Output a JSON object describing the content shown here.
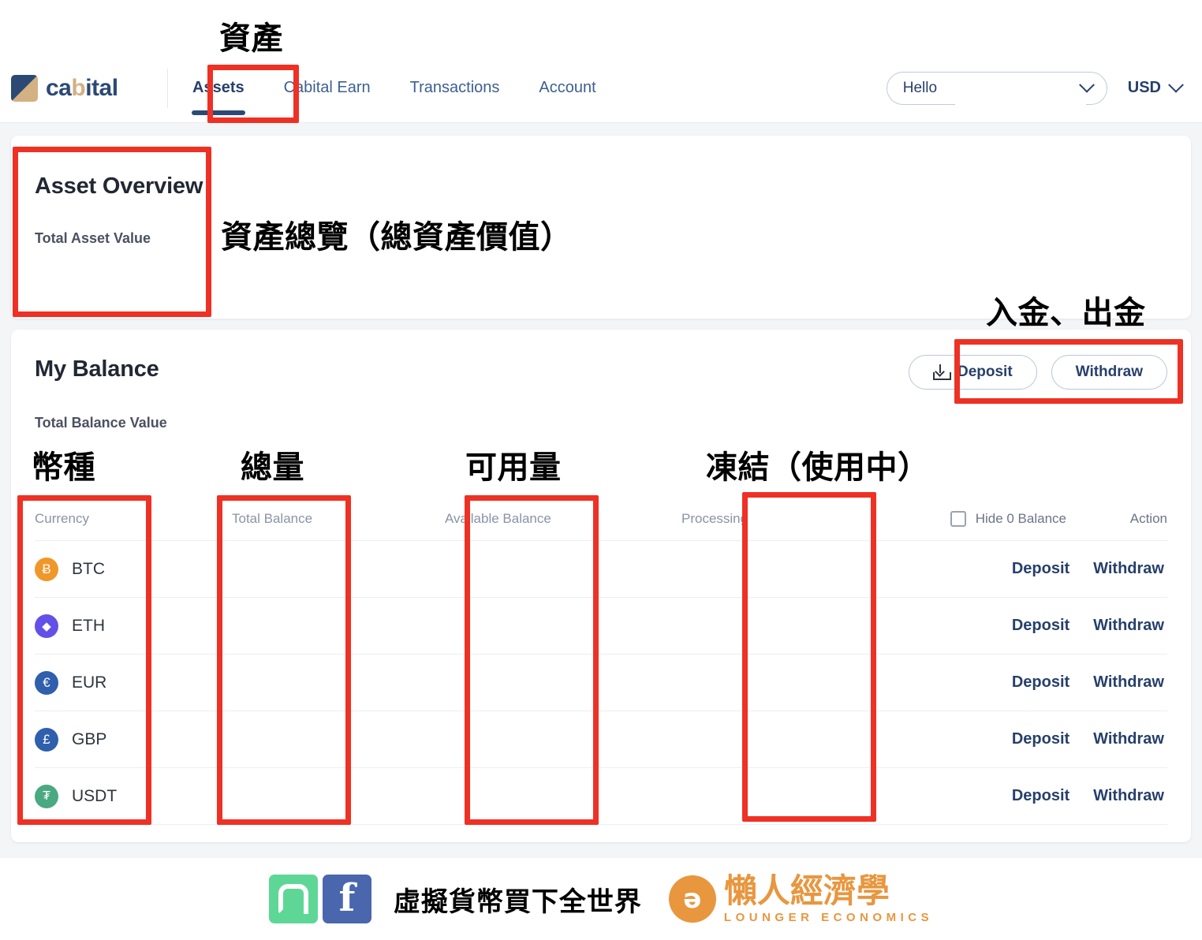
{
  "header": {
    "brand_prefix": "ca",
    "brand_mid": "b",
    "brand_suffix": "ital",
    "brand_full": "cabital",
    "nav": [
      {
        "label": "Assets",
        "active": true
      },
      {
        "label": "Cabital Earn",
        "active": false
      },
      {
        "label": "Transactions",
        "active": false
      },
      {
        "label": "Account",
        "active": false
      }
    ],
    "user_greeting": "Hello",
    "currency_selector": "USD"
  },
  "asset_overview": {
    "title": "Asset Overview",
    "subtitle": "Total Asset Value"
  },
  "my_balance": {
    "title": "My Balance",
    "subtitle": "Total Balance Value",
    "deposit_button": "Deposit",
    "withdraw_button": "Withdraw",
    "columns": {
      "currency": "Currency",
      "total_balance": "Total Balance",
      "available_balance": "Available Balance",
      "processing": "Processing",
      "hide_zero": "Hide 0 Balance",
      "action": "Action"
    },
    "row_deposit": "Deposit",
    "row_withdraw": "Withdraw",
    "rows": [
      {
        "ticker": "BTC",
        "symbol": "Ƀ",
        "color": "#f0972a",
        "total": "",
        "available": "",
        "processing": ""
      },
      {
        "ticker": "ETH",
        "symbol": "◆",
        "color": "#6350e8",
        "total": "",
        "available": "",
        "processing": ""
      },
      {
        "ticker": "EUR",
        "symbol": "€",
        "color": "#2f5fad",
        "total": "",
        "available": "",
        "processing": ""
      },
      {
        "ticker": "GBP",
        "symbol": "£",
        "color": "#2f5fad",
        "total": "",
        "available": "",
        "processing": ""
      },
      {
        "ticker": "USDT",
        "symbol": "₮",
        "color": "#4aa981",
        "total": "",
        "available": "",
        "processing": ""
      }
    ]
  },
  "annotations": [
    {
      "id": "assets-tab",
      "text": "資產"
    },
    {
      "id": "asset-overview",
      "text": "資產總覽（總資產價值）"
    },
    {
      "id": "deposit-withdraw",
      "text": "入金、出金"
    },
    {
      "id": "currency-col",
      "text": "幣種"
    },
    {
      "id": "total-col",
      "text": "總量"
    },
    {
      "id": "available-col",
      "text": "可用量"
    },
    {
      "id": "processing-col",
      "text": "凍結（使用中）"
    }
  ],
  "footer": {
    "facebook_glyph": "f",
    "slogan": "虛擬貨幣買下全世界",
    "logo_mark": "ə",
    "logo_cn": "懶人經濟學",
    "logo_en": "LOUNGER ECONOMICS"
  },
  "colors": {
    "accent": "#ee3124",
    "brand_navy": "#2c4975",
    "brand_tan": "#d3b183",
    "link": "#27406b",
    "page_bg": "#f4f5f7",
    "orange": "#e8973f"
  }
}
